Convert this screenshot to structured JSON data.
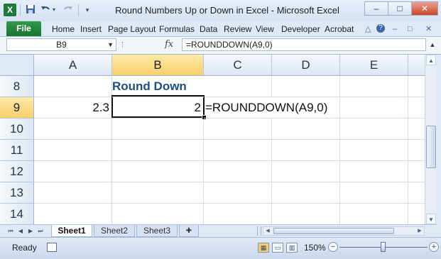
{
  "window": {
    "title": "Round Numbers Up or Down in Excel - Microsoft Excel",
    "app_icon": "excel-icon",
    "minimize": "–",
    "maximize": "□",
    "close": "✕"
  },
  "qat": {
    "save_icon": "save-icon",
    "undo_icon": "undo-icon",
    "redo_icon": "redo-icon",
    "customize_icon": "chevron-down-icon"
  },
  "ribbon": {
    "file_tab": "File",
    "tabs": [
      "Home",
      "Insert",
      "Page Layout",
      "Formulas",
      "Data",
      "Review",
      "View",
      "Developer",
      "Acrobat"
    ],
    "controls": [
      "△",
      "?",
      "–",
      "□",
      "✕"
    ]
  },
  "formula_bar": {
    "name_box": "B9",
    "fx": "fx",
    "formula": "=ROUNDDOWN(A9,0)"
  },
  "grid": {
    "columns": [
      "A",
      "B",
      "C",
      "D",
      "E"
    ],
    "rows": [
      "8",
      "9",
      "10",
      "11",
      "12",
      "13",
      "14"
    ],
    "selected_column": "B",
    "selected_row": "9",
    "cells": {
      "b8": "Round Down",
      "a9": "2.3",
      "b9": "2",
      "c9": "=ROUNDDOWN(A9,0)"
    }
  },
  "sheets": {
    "tabs": [
      "Sheet1",
      "Sheet2",
      "Sheet3"
    ],
    "active": "Sheet1"
  },
  "status": {
    "text": "Ready",
    "zoom": "150%",
    "zoom_fraction": 0.5
  },
  "colors": {
    "file_tab": "#1c7331",
    "heading_text": "#1f4e86",
    "selected_header": "#f9cf6a"
  }
}
